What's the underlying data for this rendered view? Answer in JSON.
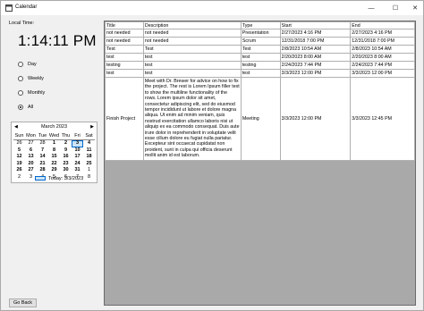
{
  "window": {
    "title": "Calendar",
    "min_glyph": "—",
    "max_glyph": "☐",
    "close_glyph": "✕"
  },
  "clock": {
    "label": "Local Time:",
    "time": "1:14:11 PM"
  },
  "view_options": [
    {
      "label": "Day",
      "selected": false
    },
    {
      "label": "Weekly",
      "selected": false
    },
    {
      "label": "Monthly",
      "selected": false
    },
    {
      "label": "All",
      "selected": true
    }
  ],
  "calendar": {
    "month": "March 2023",
    "prev": "◀",
    "next": "▶",
    "dows": [
      "Sun",
      "Mon",
      "Tue",
      "Wed",
      "Thu",
      "Fri",
      "Sat"
    ],
    "weeks": [
      [
        "26",
        "27",
        "28",
        "1",
        "2",
        "3",
        "4"
      ],
      [
        "5",
        "6",
        "7",
        "8",
        "9",
        "10",
        "11"
      ],
      [
        "12",
        "13",
        "14",
        "15",
        "16",
        "17",
        "18"
      ],
      [
        "19",
        "20",
        "21",
        "22",
        "23",
        "24",
        "25"
      ],
      [
        "26",
        "27",
        "28",
        "29",
        "30",
        "31",
        "1"
      ],
      [
        "2",
        "3",
        "4",
        "5",
        "6",
        "7",
        "8"
      ]
    ],
    "today_label": "Today: 3/3/2023"
  },
  "table": {
    "columns": [
      "Title",
      "Description",
      "Type",
      "Start",
      "End"
    ],
    "rows": [
      [
        "not needed",
        "not needed",
        "Presentation",
        "2/27/2023 4:16 PM",
        "2/27/2023 4:16 PM"
      ],
      [
        "not needed",
        "not needed",
        "Scrum",
        "12/31/2018 7:00 PM",
        "12/31/2018 7:00 PM"
      ],
      [
        "Test",
        "Test",
        "Test",
        "2/8/2023 10:54 AM",
        "2/8/2023 10:54 AM"
      ],
      [
        "test",
        "test",
        "test",
        "2/20/2023 8:00 AM",
        "2/20/2023 8:00 AM"
      ],
      [
        "testing",
        "test",
        "testing",
        "2/24/2023 7:44 PM",
        "2/24/2023 7:44 PM"
      ],
      [
        "test",
        "test",
        "test",
        "3/3/2023 12:00 PM",
        "3/3/2023 12:00 PM"
      ],
      [
        "Finish Project",
        "Meet with Dr. Brewer for advice on how to fix the project. The rest is Lorem Ipsum filler text to show the multiline functionality of the rows. Lorem ipsum dolor sit amet, consectetur adipiscing elit, sed do eiusmod tempor incididunt ut labore et dolore magna aliqua. Ut enim ad minim veniam, quis nostrud exercitation ullamco laboris nisi ut aliquip ex ea commodo consequat. Duis aute irure dolor in reprehenderit in voluptate velit esse cillum dolore eu fugiat nulla pariatur. Excepteur sint occaecat cupidatat non proident, sunt in culpa qui officia deserunt mollit anim id est laborum.",
        "Meeting",
        "3/3/2023 12:00 PM",
        "3/3/2023 12:45 PM"
      ]
    ]
  },
  "footer": {
    "back_label": "Go Back"
  }
}
